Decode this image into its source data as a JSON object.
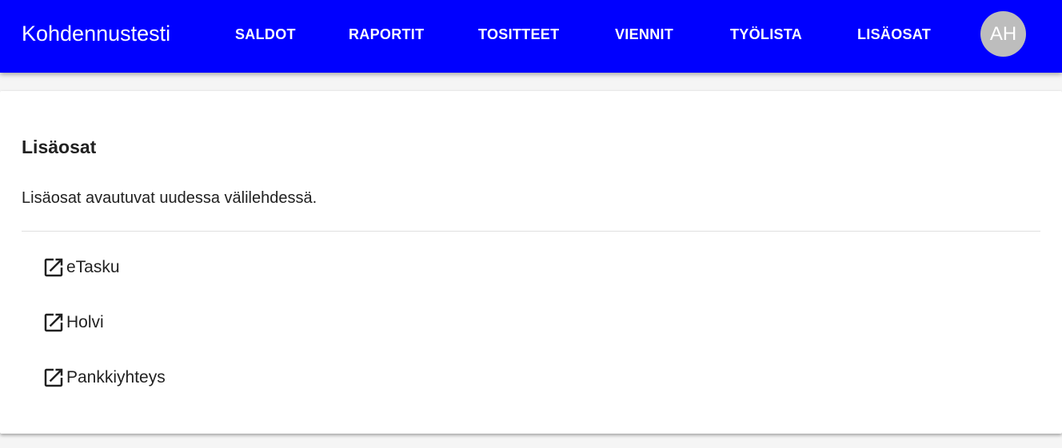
{
  "app": {
    "title": "Kohdennustesti"
  },
  "nav": {
    "items": [
      {
        "label": "SALDOT"
      },
      {
        "label": "RAPORTIT"
      },
      {
        "label": "TOSITTEET"
      },
      {
        "label": "VIENNIT"
      },
      {
        "label": "TYÖLISTA"
      },
      {
        "label": "LISÄOSAT"
      }
    ]
  },
  "user": {
    "initials": "AH"
  },
  "main": {
    "title": "Lisäosat",
    "description": "Lisäosat avautuvat uudessa välilehdessä.",
    "addons": [
      {
        "label": "eTasku",
        "icon": "open-in-new-icon"
      },
      {
        "label": "Holvi",
        "icon": "open-in-new-icon"
      },
      {
        "label": "Pankkiyhteys",
        "icon": "open-in-new-icon"
      }
    ]
  },
  "colors": {
    "appbar": "#0000ff",
    "avatar": "#bdbdbd",
    "text": "#212121"
  }
}
